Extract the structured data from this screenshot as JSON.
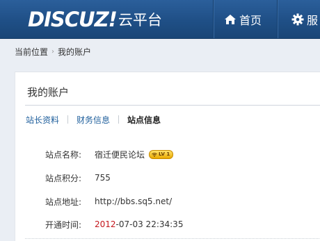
{
  "header": {
    "logo_main": "DISCUZ!",
    "logo_sub": "云平台",
    "nav": [
      {
        "label": "首页",
        "icon": "home-icon"
      },
      {
        "label": "服",
        "icon": "gear-icon"
      }
    ]
  },
  "breadcrumb": {
    "items": [
      "当前位置",
      "我的账户"
    ],
    "separator": "›"
  },
  "panel": {
    "title": "我的账户",
    "tabs": [
      {
        "label": "站长资料",
        "active": false
      },
      {
        "label": "财务信息",
        "active": false
      },
      {
        "label": "站点信息",
        "active": true
      }
    ],
    "fields": [
      {
        "label": "站点名称:",
        "value": "宿迁便民论坛",
        "badge": "LV 1"
      },
      {
        "label": "站点积分:",
        "value": "755"
      },
      {
        "label": "站点地址:",
        "value": "http://bbs.sq5.net/"
      },
      {
        "label": "开通时间:",
        "value_year": "2012",
        "value_rest": "-07-03 22:34:35"
      }
    ]
  },
  "colors": {
    "header_bg": "#1f4f86",
    "link": "#1f5f9c",
    "year_red": "#c4161c",
    "badge_gold": "#e9a900"
  }
}
